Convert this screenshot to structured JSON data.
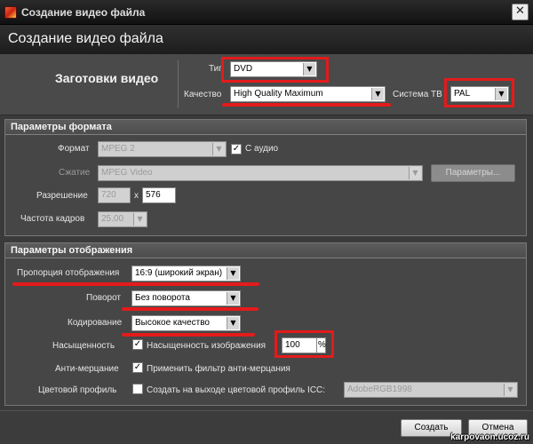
{
  "window": {
    "title": "Создание видео файла",
    "close_glyph": "✕"
  },
  "header": {
    "title": "Создание видео файла"
  },
  "presets": {
    "title": "Заготовки видео",
    "type_label": "Тип",
    "type_value": "DVD",
    "quality_label": "Качество",
    "quality_value": "High Quality Maximum",
    "tv_system_label": "Система ТВ",
    "tv_system_value": "PAL"
  },
  "format_params": {
    "title": "Параметры формата",
    "format_label": "Формат",
    "format_value": "MPEG 2",
    "with_audio_label": "С аудио",
    "compression_label": "Сжатие",
    "compression_value": "MPEG Video",
    "params_button": "Параметры...",
    "resolution_label": "Разрешение",
    "width": "720",
    "x_sep": "x",
    "height": "576",
    "framerate_label": "Частота кадров",
    "framerate_value": "25.00"
  },
  "display_params": {
    "title": "Параметры отображения",
    "aspect_label": "Пропорция отображения",
    "aspect_value": "16:9 (широкий экран)",
    "rotation_label": "Поворот",
    "rotation_value": "Без поворота",
    "encoding_label": "Кодирование",
    "encoding_value": "Высокое качество",
    "saturation_label": "Насыщенность",
    "saturation_check_label": "Насыщенность изображения",
    "saturation_value": "100",
    "saturation_unit": "%",
    "antiflicker_label": "Анти-мерцание",
    "antiflicker_check_label": "Применить фильтр анти-мерцания",
    "color_profile_label": "Цветовой профиль",
    "color_profile_check_label": "Создать на выходе цветовой профиль ICC:",
    "color_profile_value": "AdobeRGB1998"
  },
  "footer": {
    "create_button": "Создать",
    "cancel_button": "Отмена"
  },
  "watermark": "karpovaon.ucoz.ru",
  "icons": {
    "combo_arrow": "▼",
    "check": "✓"
  },
  "colors": {
    "highlight": "#e31b1b",
    "background": "#3a3a3a"
  }
}
